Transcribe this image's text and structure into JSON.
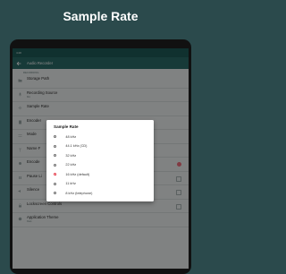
{
  "headline": "Sample Rate",
  "status_bar": {
    "time": "4:28"
  },
  "app_bar": {
    "title": "Audio Recorder"
  },
  "settings": {
    "section_label": "RECORDING",
    "rows": [
      {
        "title": "Storage Path",
        "subtitle": ""
      },
      {
        "title": "Recording Source",
        "subtitle": "Mic"
      },
      {
        "title": "Sample Rate",
        "subtitle": ""
      },
      {
        "title": "Encoder",
        "subtitle": ""
      },
      {
        "title": "Mode",
        "subtitle": ""
      },
      {
        "title": "Name F",
        "subtitle": ""
      },
      {
        "title": "Encode",
        "subtitle": ""
      },
      {
        "title": "Pause Li",
        "subtitle": ""
      },
      {
        "title": "Silence",
        "subtitle": ""
      },
      {
        "title": "Lockscreen Controls",
        "subtitle": ""
      },
      {
        "title": "Application Theme",
        "subtitle": "Dark"
      }
    ]
  },
  "dialog": {
    "title": "Sample Rate",
    "options": [
      {
        "label": "48 kHz",
        "selected": false
      },
      {
        "label": "44.1 kHz (CD)",
        "selected": false
      },
      {
        "label": "32 kHz",
        "selected": false
      },
      {
        "label": "22 kHz",
        "selected": false
      },
      {
        "label": "16 kHz (default)",
        "selected": true
      },
      {
        "label": "11 kHz",
        "selected": false
      },
      {
        "label": "8 kHz (telephone)",
        "selected": false
      }
    ]
  },
  "colors": {
    "background": "#2b4a4c",
    "app_bar": "#2c6b68",
    "accent": "#e6404f"
  }
}
